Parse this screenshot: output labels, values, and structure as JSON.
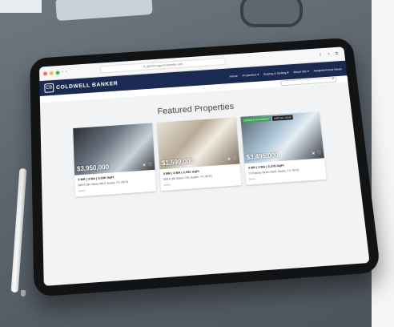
{
  "browser": {
    "url": "ff_gl2024.agent.website.com",
    "icons": "⇪ + ⧉"
  },
  "site": {
    "brand": "COLDWELL BANKER",
    "logo_letter": "CB",
    "nav": [
      "Home",
      "Properties ▾",
      "Buying & Selling ▾",
      "About Me ▾",
      "Neighborhood News"
    ]
  },
  "main": {
    "section_title": "Featured Properties",
    "cards": [
      {
        "price": "$3,950,000",
        "specs": "3 BR | 3 BA | 3,630 SqFt",
        "address": "555 E 5th Street #502, Austin, TX 78701",
        "agent": "Active",
        "badges": []
      },
      {
        "price": "$1,599,000",
        "specs": "3 BR | 3 BA | 2,952 SqFt",
        "address": "555 E 5th Street 702, Austin, TX 78701",
        "agent": "Active",
        "badges": []
      },
      {
        "price": "$3,495,000",
        "specs": "3 BR | 3 BA | 3,378 SqFt",
        "address": "70 Rainey Street 3305, Austin, TX 78701",
        "agent": "Active",
        "badges": [
          "LISTED & ON MARKET",
          "VIRTUAL TOUR"
        ]
      }
    ]
  },
  "colors": {
    "header": "#1a2a52",
    "badge_new": "#3aa45b"
  }
}
